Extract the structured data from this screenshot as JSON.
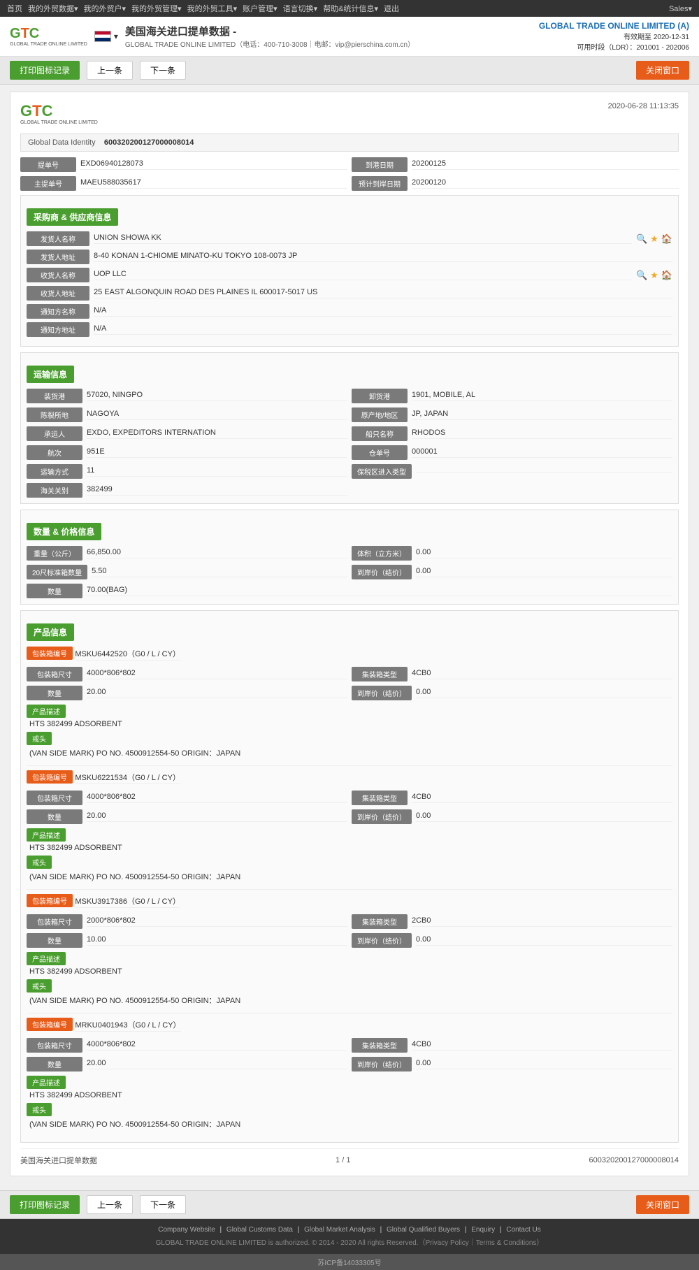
{
  "topnav": {
    "items": [
      "首页",
      "我的外贸数据▾",
      "我的外贸户▾",
      "我的外贸管理▾",
      "我的外贸工具▾",
      "账户管理▾",
      "语言切换▾",
      "帮助&统计信息▾",
      "退出"
    ],
    "right": "Sales▾"
  },
  "header": {
    "logo": "GTC",
    "logo_sub": "GLOBAL TRADE ONLINE LIMITED",
    "flag_alt": "US Flag",
    "title": "美国海关进口提单数据 -",
    "subtitle": "GLOBAL TRADE ONLINE LIMITED（电话：400-710-3008｜电邮：vip@pierschina.com.cn）",
    "brand": "GLOBAL TRADE ONLINE LIMITED (A)",
    "expiry": "有效期至 2020-12-31",
    "quota": "可用时段（LDR）：201001 - 202006"
  },
  "toolbar": {
    "print": "打印图标记录",
    "prev": "上一条",
    "next": "下一条",
    "close": "关闭窗口"
  },
  "record": {
    "logo": "GTC",
    "logo_sub": "GLOBAL TRADE ONLINE LIMITED",
    "datetime": "2020-06-28 11:13:35",
    "gdi_label": "Global Data Identity",
    "gdi_value": "600320200127000008014",
    "bill_no_label": "提单号",
    "bill_no_value": "EXD06940128073",
    "arrival_label": "到港日期",
    "arrival_value": "20200125",
    "main_bill_label": "主提单号",
    "main_bill_value": "MAEU588035617",
    "est_arrival_label": "预计到岸日期",
    "est_arrival_value": "20200120"
  },
  "shipper_section": {
    "title": "采购商 & 供应商信息",
    "shipper_label": "发货人名称",
    "shipper_value": "UNION SHOWA KK",
    "shipper_addr_label": "发货人地址",
    "shipper_addr_value": "8-40 KONAN 1-CHIOME MINATO-KU TOKYO 108-0073 JP",
    "consignee_label": "收货人名称",
    "consignee_value": "UOP LLC",
    "consignee_addr_label": "收货人地址",
    "consignee_addr_value": "25 EAST ALGONQUIN ROAD DES PLAINES IL 600017-5017 US",
    "notify_label": "通知方名称",
    "notify_value": "N/A",
    "notify_addr_label": "通知方地址",
    "notify_addr_value": "N/A"
  },
  "transport_section": {
    "title": "运输信息",
    "loading_port_label": "装货港",
    "loading_port_value": "57020, NINGPO",
    "discharge_port_label": "卸货港",
    "discharge_port_value": "1901, MOBILE, AL",
    "place_of_delivery_label": "陈裂所地",
    "place_of_delivery_value": "NAGOYA",
    "origin_country_label": "原产地/地区",
    "origin_country_value": "JP, JAPAN",
    "carrier_label": "承运人",
    "carrier_value": "EXDO, EXPEDITORS INTERNATION",
    "vessel_label": "船只名称",
    "vessel_value": "RHODOS",
    "voyage_label": "航次",
    "voyage_value": "951E",
    "bill_of_lading_label": "仓单号",
    "bill_of_lading_value": "000001",
    "transport_mode_label": "运输方式",
    "transport_mode_value": "11",
    "customs_zone_label": "保税区进入类型",
    "customs_zone_value": "",
    "customs_no_label": "海关关别",
    "customs_no_value": "382499"
  },
  "numbers_section": {
    "title": "数量 & 价格信息",
    "weight_label": "重量（公斤）",
    "weight_value": "66,850.00",
    "volume_label": "体积（立方米）",
    "volume_value": "0.00",
    "std20_label": "20尺标准箱数量",
    "std20_value": "5.50",
    "unit_price_label": "到岸价（结价）",
    "unit_price_value": "0.00",
    "quantity_label": "数量",
    "quantity_value": "70.00(BAG)"
  },
  "product_section": {
    "title": "产品信息",
    "products": [
      {
        "container_no_label": "包装箱编号",
        "container_no_value": "MSKU6442520（G0 / L / CY）",
        "container_size_label": "包装箱尺寸",
        "container_size_value": "4000*806*802",
        "container_type_label": "集装箱类型",
        "container_type_value": "4CB0",
        "quantity_label": "数量",
        "quantity_value": "20.00",
        "unit_price_label": "到岸价（结价）",
        "unit_price_value": "0.00",
        "desc_label": "产品描述",
        "desc_value": "HTS 382499 ADSORBENT",
        "mark_label": "戒头",
        "mark_value": "(VAN SIDE MARK) PO NO. 4500912554-50 ORIGIN：JAPAN"
      },
      {
        "container_no_label": "包装箱编号",
        "container_no_value": "MSKU6221534（G0 / L / CY）",
        "container_size_label": "包装箱尺寸",
        "container_size_value": "4000*806*802",
        "container_type_label": "集装箱类型",
        "container_type_value": "4CB0",
        "quantity_label": "数量",
        "quantity_value": "20.00",
        "unit_price_label": "到岸价（结价）",
        "unit_price_value": "0.00",
        "desc_label": "产品描述",
        "desc_value": "HTS 382499 ADSORBENT",
        "mark_label": "戒头",
        "mark_value": "(VAN SIDE MARK) PO NO. 4500912554-50 ORIGIN：JAPAN"
      },
      {
        "container_no_label": "包装箱编号",
        "container_no_value": "MSKU3917386（G0 / L / CY）",
        "container_size_label": "包装箱尺寸",
        "container_size_value": "2000*806*802",
        "container_type_label": "集装箱类型",
        "container_type_value": "2CB0",
        "quantity_label": "数量",
        "quantity_value": "10.00",
        "unit_price_label": "到岸价（结价）",
        "unit_price_value": "0.00",
        "desc_label": "产品描述",
        "desc_value": "HTS 382499 ADSORBENT",
        "mark_label": "戒头",
        "mark_value": "(VAN SIDE MARK) PO NO. 4500912554-50 ORIGIN：JAPAN"
      },
      {
        "container_no_label": "包装箱编号",
        "container_no_value": "MRKU0401943（G0 / L / CY）",
        "container_size_label": "包装箱尺寸",
        "container_size_value": "4000*806*802",
        "container_type_label": "集装箱类型",
        "container_type_value": "4CB0",
        "quantity_label": "数量",
        "quantity_value": "20.00",
        "unit_price_label": "到岸价（结价）",
        "unit_price_value": "0.00",
        "desc_label": "产品描述",
        "desc_value": "HTS 382499 ADSORBENT",
        "mark_label": "戒头",
        "mark_value": "(VAN SIDE MARK) PO NO. 4500912554-50 ORIGIN：JAPAN"
      }
    ]
  },
  "card_footer": {
    "left": "美国海关进口提单数据",
    "page": "1 / 1",
    "right": "600320200127000008014"
  },
  "site_footer": {
    "links": [
      "Company Website",
      "Global Customs Data",
      "Global Market Analysis",
      "Global Qualified Buyers",
      "Enquiry",
      "Contact Us"
    ],
    "copyright": "GLOBAL TRADE ONLINE LIMITED is authorized. © 2014 - 2020 All rights Reserved.（Privacy Policy｜Terms & Conditions）",
    "beian": "苏ICP备14033305号"
  }
}
